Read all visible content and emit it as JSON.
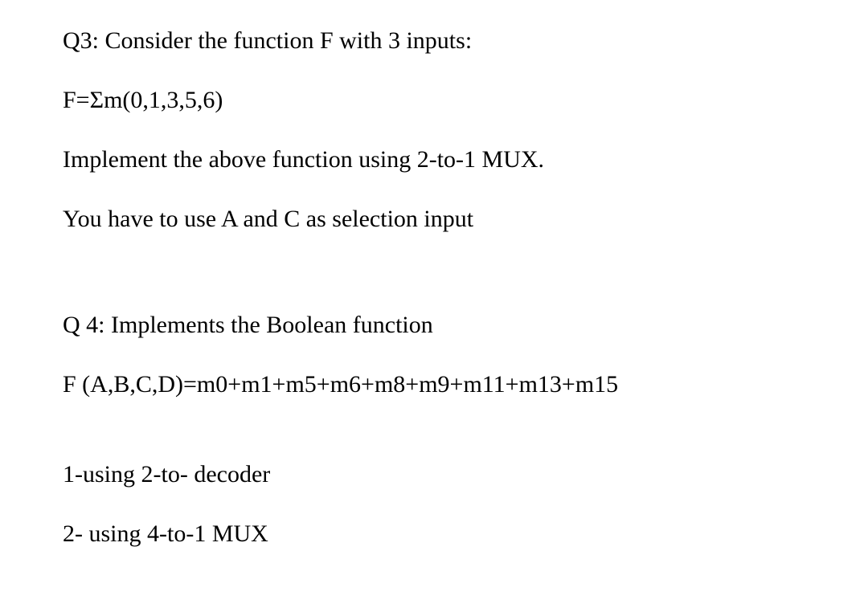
{
  "q3": {
    "title": "Q3: Consider the function F with 3 inputs:",
    "formula": "F=Σm(0,1,3,5,6)",
    "instruction1": "Implement the above function using 2-to-1 MUX.",
    "instruction2": "You have to use A and C as selection input"
  },
  "q4": {
    "title": "Q 4: Implements the Boolean function",
    "formula": "F (A,B,C,D)=m0+m1+m5+m6+m8+m9+m11+m13+m15",
    "option1": "1-using 2-to- decoder",
    "option2": "2- using 4-to-1 MUX"
  }
}
